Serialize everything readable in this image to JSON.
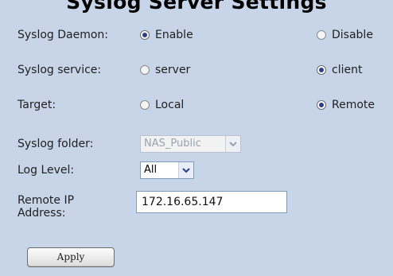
{
  "page": {
    "title": "Syslog Server Settings"
  },
  "syslog_daemon": {
    "label": "Syslog Daemon:",
    "options": [
      {
        "label": "Enable",
        "selected": true
      },
      {
        "label": "Disable",
        "selected": false
      }
    ]
  },
  "syslog_service": {
    "label": "Syslog service:",
    "options": [
      {
        "label": "server",
        "selected": false
      },
      {
        "label": "client",
        "selected": true
      }
    ]
  },
  "target": {
    "label": "Target:",
    "options": [
      {
        "label": "Local",
        "selected": false
      },
      {
        "label": "Remote",
        "selected": true
      }
    ]
  },
  "syslog_folder": {
    "label": "Syslog folder:",
    "value": "NAS_Public",
    "disabled": true
  },
  "log_level": {
    "label": "Log Level:",
    "value": "All"
  },
  "remote_ip": {
    "label_line1": "Remote IP",
    "label_line2": "Address:",
    "value": "172.16.65.147"
  },
  "apply_button": {
    "label": "Apply"
  },
  "colors": {
    "background": "#c8d5e8",
    "radio_dot": "#2d3c8c"
  }
}
